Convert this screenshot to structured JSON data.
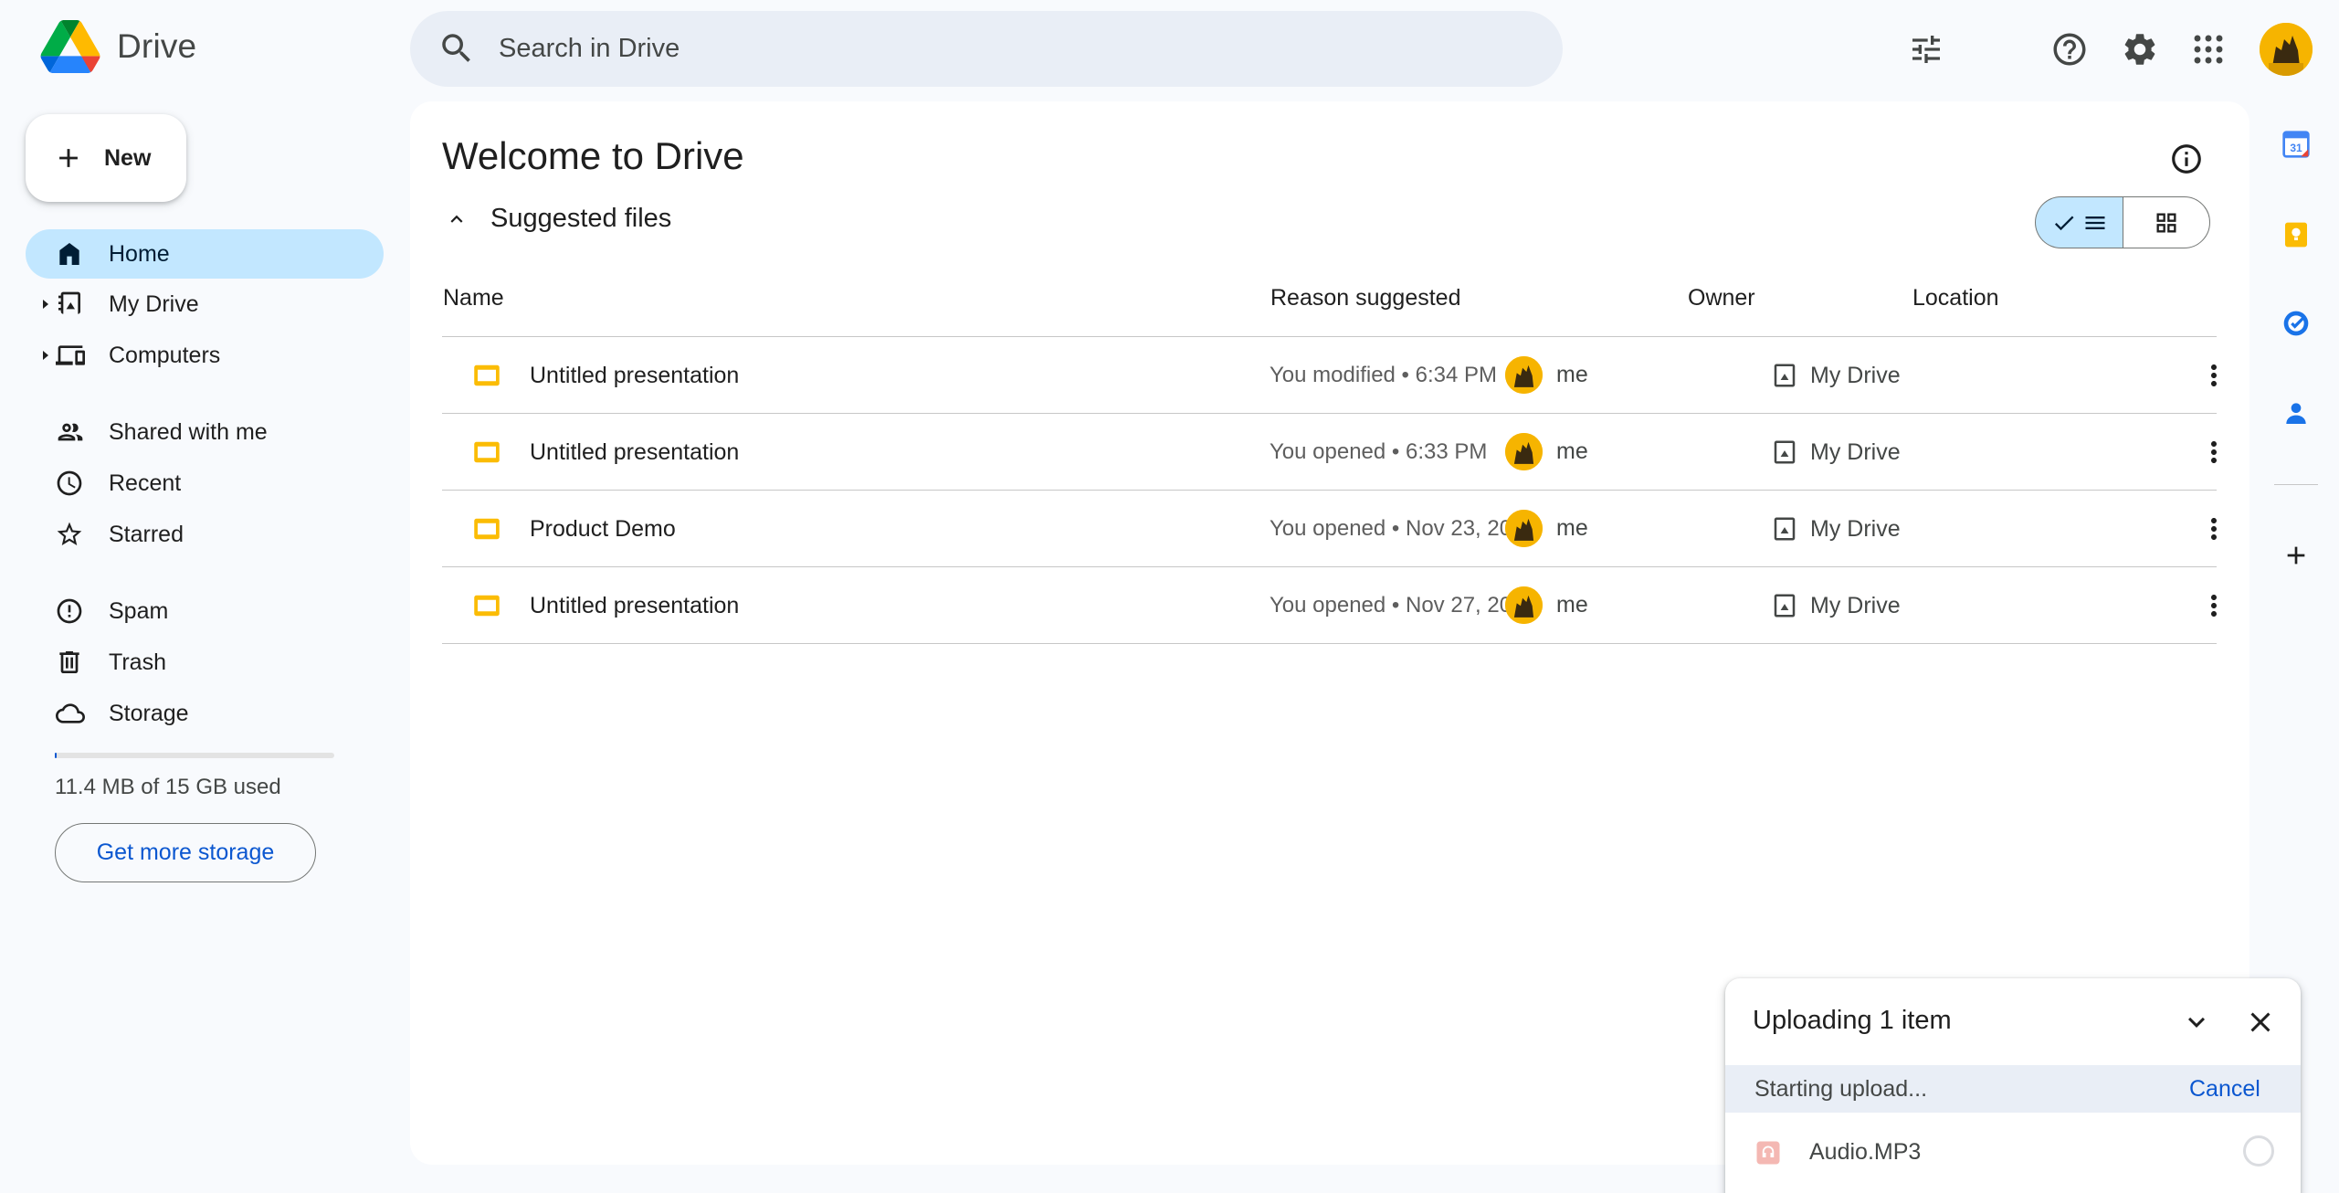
{
  "app": {
    "name": "Drive"
  },
  "search": {
    "placeholder": "Search in Drive"
  },
  "nav": {
    "new_label": "New",
    "items": [
      {
        "label": "Home",
        "icon": "home-icon",
        "active": true
      },
      {
        "label": "My Drive",
        "icon": "my-drive-icon"
      },
      {
        "label": "Computers",
        "icon": "computers-icon"
      },
      {
        "label": "Shared with me",
        "icon": "shared-icon"
      },
      {
        "label": "Recent",
        "icon": "clock-icon"
      },
      {
        "label": "Starred",
        "icon": "star-icon"
      },
      {
        "label": "Spam",
        "icon": "spam-icon"
      },
      {
        "label": "Trash",
        "icon": "trash-icon"
      },
      {
        "label": "Storage",
        "icon": "cloud-icon"
      }
    ],
    "storage_used_fraction": 0.0008,
    "storage_text": "11.4 MB of 15 GB used",
    "get_storage_label": "Get more storage"
  },
  "main": {
    "title": "Welcome to Drive",
    "section_label": "Suggested files",
    "columns": {
      "name": "Name",
      "reason": "Reason suggested",
      "owner": "Owner",
      "location": "Location"
    },
    "rows": [
      {
        "name": "Untitled presentation",
        "reason": "You modified • 6:34 PM",
        "owner": "me",
        "location": "My Drive"
      },
      {
        "name": "Untitled presentation",
        "reason": "You opened • 6:33 PM",
        "owner": "me",
        "location": "My Drive"
      },
      {
        "name": "Product Demo",
        "reason": "You opened • Nov 23, 2024",
        "owner": "me",
        "location": "My Drive"
      },
      {
        "name": "Untitled presentation",
        "reason": "You opened • Nov 27, 2024",
        "owner": "me",
        "location": "My Drive"
      }
    ]
  },
  "upload": {
    "title": "Uploading 1 item",
    "status": "Starting upload...",
    "cancel_label": "Cancel",
    "file_name": "Audio.MP3"
  },
  "colors": {
    "accent": "#0b57d0",
    "active_nav": "#c2e7ff",
    "slides_yellow": "#fbbc04",
    "background": "#f8fafd"
  }
}
